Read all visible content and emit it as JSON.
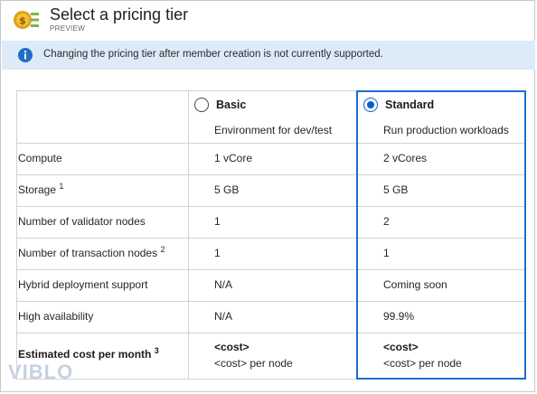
{
  "header": {
    "title": "Select a pricing tier",
    "subtitle": "PREVIEW",
    "logo_icon": "pricing-tier-logo"
  },
  "banner": {
    "text": "Changing the pricing tier after member creation is not currently supported.",
    "icon": "info-icon",
    "background": "#dcebf7"
  },
  "tiers": [
    {
      "name": "Basic",
      "description": "Environment for dev/test",
      "selected": false
    },
    {
      "name": "Standard",
      "description": "Run production workloads",
      "selected": true
    }
  ],
  "rows": [
    {
      "label": "Compute",
      "sup": "",
      "basic": "1 vCore",
      "standard": "2 vCores"
    },
    {
      "label": "Storage",
      "sup": "1",
      "basic": "5 GB",
      "standard": "5 GB"
    },
    {
      "label": "Number of validator nodes",
      "sup": "",
      "basic": "1",
      "standard": "2"
    },
    {
      "label": "Number of transaction nodes",
      "sup": "2",
      "basic": "1",
      "standard": "1"
    },
    {
      "label": "Hybrid deployment support",
      "sup": "",
      "basic": "N/A",
      "standard": "Coming soon"
    },
    {
      "label": "High availability",
      "sup": "",
      "basic": "N/A",
      "standard": "99.9%"
    }
  ],
  "cost": {
    "label": "Estimated cost per month",
    "sup": "3",
    "basic_main": "<cost>",
    "basic_sub": "<cost> per node",
    "standard_main": "<cost>",
    "standard_sub": "<cost> per node"
  },
  "watermark": "VIBLO",
  "accent": "#1c6dd0"
}
